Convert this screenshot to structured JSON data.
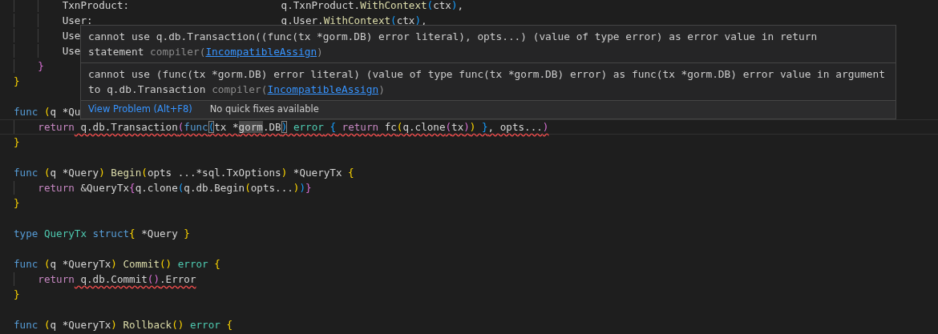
{
  "editor": {
    "lines": [
      {
        "tokens": [
          {
            "text": "        TxnProduct:                         q.TxnProduct.",
            "kind": "plain"
          },
          {
            "text": "WithContext",
            "kind": "func"
          },
          {
            "text": "(",
            "kind": "b3"
          },
          {
            "text": "ctx",
            "kind": "plain"
          },
          {
            "text": ")",
            "kind": "b3"
          },
          {
            "text": ",",
            "kind": "plain"
          }
        ]
      },
      {
        "tokens": [
          {
            "text": "        User:                               q.User.",
            "kind": "plain"
          },
          {
            "text": "WithContext",
            "kind": "func"
          },
          {
            "text": "(",
            "kind": "b3"
          },
          {
            "text": "ctx",
            "kind": "plain"
          },
          {
            "text": ")",
            "kind": "b3"
          },
          {
            "text": ",",
            "kind": "plain"
          }
        ]
      },
      {
        "tokens": [
          {
            "text": "        Use",
            "kind": "plain"
          }
        ]
      },
      {
        "tokens": [
          {
            "text": "        Use",
            "kind": "plain"
          }
        ]
      },
      {
        "tokens": [
          {
            "text": "    }",
            "kind": "b2"
          }
        ]
      },
      {
        "blank_line_after": true,
        "tokens": [
          {
            "text": "}",
            "kind": "b1"
          }
        ]
      },
      {
        "tokens": [
          {
            "text": "func",
            "kind": "keyword"
          },
          {
            "text": " (",
            "kind": "b1"
          },
          {
            "text": "q *Qu",
            "kind": "plain"
          }
        ]
      },
      {
        "current": true,
        "tokens": [
          {
            "text": "    return",
            "kind": "control"
          },
          {
            "text": " q.db.Transaction",
            "kind": "plain",
            "squiggle": true
          },
          {
            "text": "(",
            "kind": "b2",
            "squiggle": true
          },
          {
            "text": "func",
            "kind": "keyword",
            "squiggle": true
          },
          {
            "text": "(",
            "kind": "b3",
            "squiggle": true,
            "boxed": true
          },
          {
            "text": "tx *",
            "kind": "plain",
            "squiggle": true
          },
          {
            "text": "gorm",
            "kind": "plain",
            "squiggle": true,
            "highlighted": true
          },
          {
            "text": ".DB",
            "kind": "plain",
            "squiggle": true
          },
          {
            "text": ")",
            "kind": "b3",
            "squiggle": true,
            "boxed": true
          },
          {
            "text": " error",
            "kind": "type",
            "squiggle": true
          },
          {
            "text": " {",
            "kind": "b3",
            "squiggle": true
          },
          {
            "text": " return",
            "kind": "control",
            "squiggle": true
          },
          {
            "text": " fc",
            "kind": "plain",
            "squiggle": true
          },
          {
            "text": "(",
            "kind": "b1",
            "squiggle": true
          },
          {
            "text": "q.clone",
            "kind": "plain",
            "squiggle": true
          },
          {
            "text": "(",
            "kind": "b2",
            "squiggle": true
          },
          {
            "text": "tx",
            "kind": "plain",
            "squiggle": true
          },
          {
            "text": ")",
            "kind": "b2",
            "squiggle": true
          },
          {
            "text": ")",
            "kind": "b1",
            "squiggle": true
          },
          {
            "text": " }",
            "kind": "b3",
            "squiggle": true
          },
          {
            "text": ", opts...",
            "kind": "plain",
            "squiggle": true
          },
          {
            "text": ")",
            "kind": "b2",
            "squiggle": true
          }
        ]
      },
      {
        "blank_line_after": true,
        "tokens": [
          {
            "text": "}",
            "kind": "b1"
          }
        ]
      },
      {
        "tokens": [
          {
            "text": "func",
            "kind": "keyword"
          },
          {
            "text": " (",
            "kind": "b1"
          },
          {
            "text": "q *Query",
            "kind": "plain"
          },
          {
            "text": ")",
            "kind": "b1"
          },
          {
            "text": " Begin",
            "kind": "func"
          },
          {
            "text": "(",
            "kind": "b1"
          },
          {
            "text": "opts ...*sql.TxOptions",
            "kind": "plain"
          },
          {
            "text": ")",
            "kind": "b1"
          },
          {
            "text": " *QueryTx",
            "kind": "plain"
          },
          {
            "text": " {",
            "kind": "b1"
          }
        ]
      },
      {
        "tokens": [
          {
            "text": "    return",
            "kind": "control"
          },
          {
            "text": " &QueryTx",
            "kind": "plain"
          },
          {
            "text": "{",
            "kind": "b2"
          },
          {
            "text": "q.clone",
            "kind": "plain"
          },
          {
            "text": "(",
            "kind": "b3"
          },
          {
            "text": "q.db.Begin",
            "kind": "plain"
          },
          {
            "text": "(",
            "kind": "b1"
          },
          {
            "text": "opts...",
            "kind": "plain"
          },
          {
            "text": ")",
            "kind": "b1"
          },
          {
            "text": ")",
            "kind": "b3"
          },
          {
            "text": "}",
            "kind": "b2"
          }
        ]
      },
      {
        "blank_line_after": true,
        "tokens": [
          {
            "text": "}",
            "kind": "b1"
          }
        ]
      },
      {
        "tokens": [
          {
            "text": "type",
            "kind": "keyword"
          },
          {
            "text": " QueryTx",
            "kind": "type"
          },
          {
            "text": " struct",
            "kind": "keyword"
          },
          {
            "text": "{",
            "kind": "b1"
          },
          {
            "text": " *Query",
            "kind": "plain"
          },
          {
            "text": " }",
            "kind": "b1"
          }
        ],
        "blank_line_after": true
      },
      {
        "tokens": [
          {
            "text": "func",
            "kind": "keyword"
          },
          {
            "text": " (",
            "kind": "b1"
          },
          {
            "text": "q *QueryTx",
            "kind": "plain"
          },
          {
            "text": ")",
            "kind": "b1"
          },
          {
            "text": " Commit",
            "kind": "func"
          },
          {
            "text": "()",
            "kind": "b1"
          },
          {
            "text": " error",
            "kind": "type"
          },
          {
            "text": " {",
            "kind": "b1"
          }
        ]
      },
      {
        "tokens": [
          {
            "text": "    return",
            "kind": "control"
          },
          {
            "text": " q.db.Commit",
            "kind": "plain",
            "squiggle": true
          },
          {
            "text": "()",
            "kind": "b2",
            "squiggle": true
          },
          {
            "text": ".Error",
            "kind": "plain",
            "squiggle": true
          }
        ]
      },
      {
        "blank_line_after": true,
        "tokens": [
          {
            "text": "}",
            "kind": "b1"
          }
        ]
      },
      {
        "tokens": [
          {
            "text": "func",
            "kind": "keyword"
          },
          {
            "text": " (",
            "kind": "b1"
          },
          {
            "text": "q *QueryTx",
            "kind": "plain"
          },
          {
            "text": ")",
            "kind": "b1"
          },
          {
            "text": " Rollback",
            "kind": "func"
          },
          {
            "text": "()",
            "kind": "b1"
          },
          {
            "text": " error",
            "kind": "type"
          },
          {
            "text": " {",
            "kind": "b1"
          }
        ]
      }
    ]
  },
  "hover": {
    "problems": [
      {
        "message": "cannot use q.db.Transaction((func(tx *gorm.DB) error literal), opts...) (value of type error) as error value in return statement",
        "source": "compiler(",
        "code": "IncompatibleAssign",
        "close": ")"
      },
      {
        "message": "cannot use (func(tx *gorm.DB) error literal) (value of type func(tx *gorm.DB) error) as func(tx *gorm.DB) error value in argument to q.db.Transaction",
        "source": "compiler(",
        "code": "IncompatibleAssign",
        "close": ")"
      }
    ],
    "actions": {
      "view_problem": "View Problem (Alt+F8)",
      "quick_fix": "No quick fixes available"
    }
  }
}
